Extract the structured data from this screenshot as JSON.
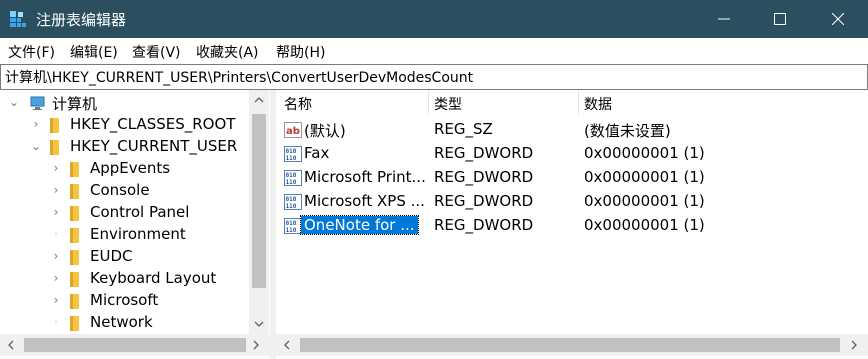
{
  "window": {
    "title": "注册表编辑器",
    "buttons": {
      "minimize": "—",
      "maximize": "☐",
      "close": "✕"
    }
  },
  "menu": [
    "文件(F)",
    "编辑(E)",
    "查看(V)",
    "收藏夹(A)",
    "帮助(H)"
  ],
  "address": "计算机\\HKEY_CURRENT_USER\\Printers\\ConvertUserDevModesCount",
  "tree": {
    "root": "计算机",
    "hives": [
      "HKEY_CLASSES_ROOT",
      "HKEY_CURRENT_USER"
    ],
    "children": [
      "AppEvents",
      "Console",
      "Control Panel",
      "Environment",
      "EUDC",
      "Keyboard Layout",
      "Microsoft",
      "Network"
    ]
  },
  "list": {
    "columns": [
      "名称",
      "类型",
      "数据"
    ],
    "rows": [
      {
        "name": "(默认)",
        "type": "REG_SZ",
        "data": "(数值未设置)",
        "icon": "string-value-icon"
      },
      {
        "name": "Fax",
        "type": "REG_DWORD",
        "data": "0x00000001 (1)",
        "icon": "dword-value-icon"
      },
      {
        "name": "Microsoft Print...",
        "type": "REG_DWORD",
        "data": "0x00000001 (1)",
        "icon": "dword-value-icon"
      },
      {
        "name": "Microsoft XPS ...",
        "type": "REG_DWORD",
        "data": "0x00000001 (1)",
        "icon": "dword-value-icon"
      },
      {
        "name": "OneNote for ...",
        "type": "REG_DWORD",
        "data": "0x00000001 (1)",
        "icon": "dword-value-icon",
        "selected": true
      }
    ]
  },
  "colors": {
    "titlebar": "#2b4f5e",
    "selection": "#0078d7",
    "folder": "#f6c443"
  }
}
